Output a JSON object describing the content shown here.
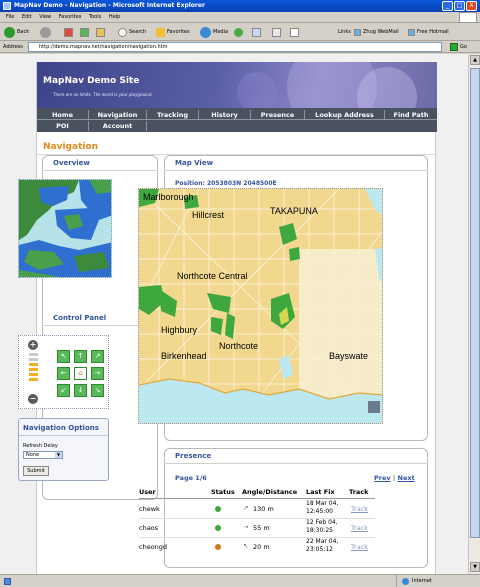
{
  "window": {
    "title": "MapNav Demo - Navigation - Microsoft Internet Explorer",
    "minimize": "_",
    "maximize": "□",
    "close": "X"
  },
  "menu": [
    "File",
    "Edit",
    "View",
    "Favorites",
    "Tools",
    "Help"
  ],
  "toolbar": {
    "back": "Back",
    "search": "Search",
    "favorites": "Favorites",
    "media": "Media",
    "links": "Links",
    "link1": "Zhug WebMail",
    "link2": "Free Hotmail"
  },
  "address": {
    "label": "Address",
    "url": "http://demo.mapnav.net/navigation/navigation.htm",
    "go": "Go"
  },
  "site": {
    "title": "MapNav Demo Site",
    "tagline": "There are no limits. The world is your playground"
  },
  "nav": [
    {
      "label": "Home"
    },
    {
      "label": "Navigation"
    },
    {
      "label": "Tracking"
    },
    {
      "label": "History"
    },
    {
      "label": "Presence"
    },
    {
      "label": "Lookup Address"
    },
    {
      "label": "Find Path"
    },
    {
      "label": "POI"
    },
    {
      "label": "Account"
    }
  ],
  "page_title": "Navigation",
  "overview": {
    "title": "Overview"
  },
  "control_panel": {
    "title": "Control Panel",
    "zoom_in": "+",
    "zoom_out": "−",
    "zoom_level_fraction": 0.5
  },
  "nav_options": {
    "title": "Navigation Options",
    "refresh_label": "Refresh Delay",
    "refresh_value": "None",
    "submit": "Submit"
  },
  "map_view": {
    "title": "Map View",
    "position": "Position: 2053803N 2048500E",
    "labels": [
      "Marlborough",
      "Hillcrest",
      "TAKAPUNA",
      "Northcote Central",
      "Highbury",
      "Birkenhead",
      "Northcote",
      "Bayswate"
    ]
  },
  "presence": {
    "title": "Presence",
    "page": "Page 1/6",
    "prev": "Prev",
    "sep": "|",
    "next": "Next",
    "columns": [
      "User",
      "Status",
      "Angle/Distance",
      "Last Fix",
      "Track"
    ],
    "rows": [
      {
        "user": "chewk",
        "status_color": "#3aa83a",
        "distance": "130 m",
        "fix_date": "18 Mar 04,",
        "fix_time": "12:45:00",
        "track": "Track"
      },
      {
        "user": "chaos",
        "status_color": "#3aa83a",
        "distance": "55 m",
        "fix_date": "12 Feb 04,",
        "fix_time": "18:30:25",
        "track": "Track"
      },
      {
        "user": "cheongd",
        "status_color": "#d07820",
        "distance": "20 m",
        "fix_date": "22 Mar 04,",
        "fix_time": "23:05:12",
        "track": "Track"
      }
    ]
  },
  "status": {
    "zone": "Internet"
  }
}
